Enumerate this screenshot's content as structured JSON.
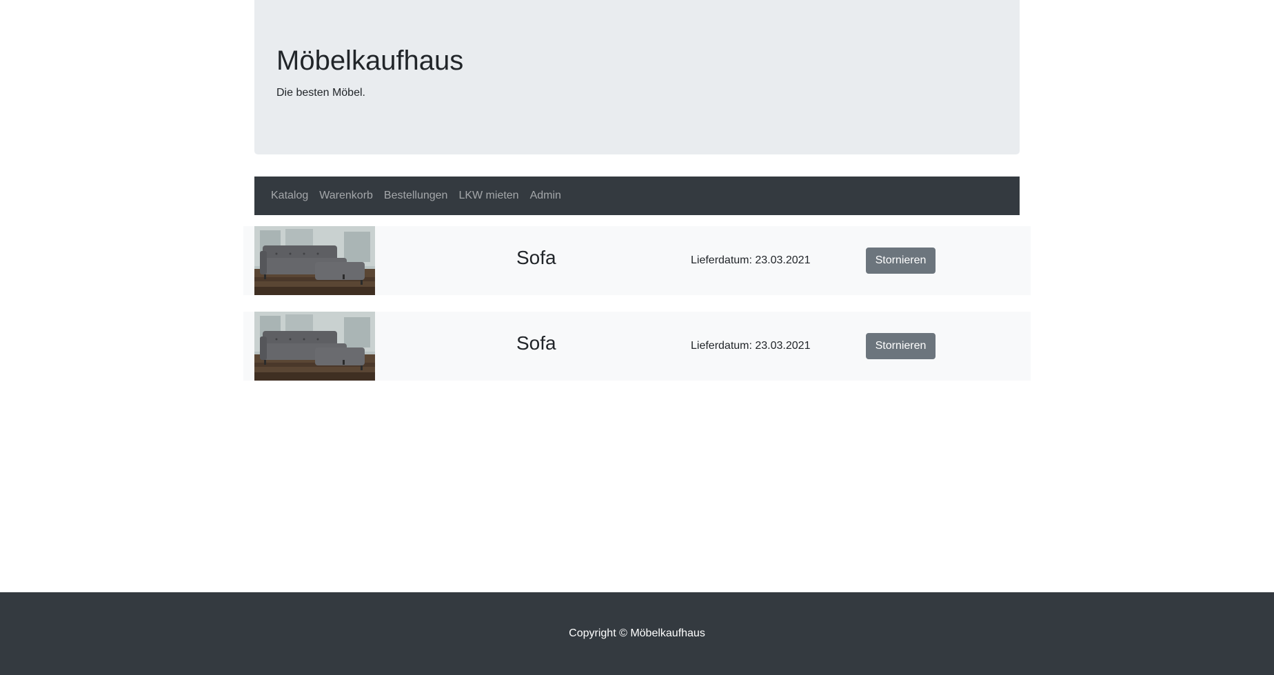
{
  "header": {
    "title": "Möbelkaufhaus",
    "subtitle": "Die besten Möbel."
  },
  "nav": {
    "items": [
      {
        "label": "Katalog"
      },
      {
        "label": "Warenkorb"
      },
      {
        "label": "Bestellungen"
      },
      {
        "label": "LKW mieten"
      },
      {
        "label": "Admin"
      }
    ]
  },
  "orders": [
    {
      "title": "Sofa",
      "delivery": "Lieferdatum: 23.03.2021",
      "cancel_label": "Stornieren",
      "image_alt": "Sofa"
    },
    {
      "title": "Sofa",
      "delivery": "Lieferdatum: 23.03.2021",
      "cancel_label": "Stornieren",
      "image_alt": "Sofa"
    }
  ],
  "footer": {
    "copyright": "Copyright © Möbelkaufhaus"
  }
}
